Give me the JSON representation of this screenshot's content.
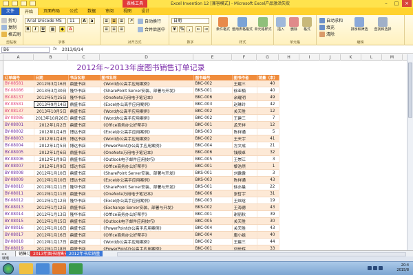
{
  "window": {
    "context_tab": "表格工具",
    "title": "Excel Invention 12 [兼容模式] - Microsoft Excel产品激活失败"
  },
  "ribbon_tabs": [
    "文件",
    "开始",
    "页面布局",
    "公式",
    "数据",
    "审阅",
    "视图",
    "设计"
  ],
  "ribbon": {
    "clipboard": {
      "cut": "剪切",
      "copy": "复制",
      "format_painter": "格式刷",
      "paste": "粘贴",
      "group": "剪贴板"
    },
    "font": {
      "name": "Arial Unicode MS",
      "size": "11",
      "group": "字体"
    },
    "alignment": {
      "wrap": "自动换行",
      "merge": "合并后居中",
      "group": "对齐方式"
    },
    "number": {
      "format": "日期",
      "group": "数字"
    },
    "styles": {
      "conditional": "条件格式",
      "table": "套用表格格式",
      "cell": "单元格样式",
      "group": "样式"
    },
    "cells": {
      "insert": "插入",
      "delete": "删除",
      "format": "格式",
      "group": "单元格"
    },
    "editing": {
      "autosum": "自动求和",
      "fill": "填充",
      "clear": "清除",
      "sort": "排序和筛选",
      "find": "查找和选择",
      "group": "编辑"
    }
  },
  "formula_bar": {
    "name_box": "B6",
    "fx": "fx",
    "value": "2013/9/14"
  },
  "columns": [
    "A",
    "B",
    "C",
    "D",
    "E",
    "F",
    "G",
    "H",
    "I",
    "J",
    "K",
    "L",
    "M",
    "N"
  ],
  "sheet": {
    "title": "2012年~2013年度图书销售订单记录",
    "headers": [
      "订单编号",
      "日期",
      "书店名称",
      "图书名称",
      "图书编号",
      "图书作者",
      "销量（本）"
    ],
    "rows": [
      {
        "num": "BY-08581",
        "date": "2012年3月16日",
        "store": "鼎盛书店",
        "book": "《Word办公高手应用案例》",
        "code": "BKC-002",
        "author": "王建三",
        "qty": "40"
      },
      {
        "num": "BY-08086",
        "date": "2013年3月30日",
        "store": "隆华书店",
        "book": "《SharePoint Server安装、部署与开发》",
        "code": "BKS-001",
        "author": "徐亚楠",
        "qty": "40"
      },
      {
        "num": "BY-08137",
        "date": "2012年5月25日",
        "store": "隆华书店",
        "book": "《OneNote万用电子笔记本》",
        "code": "BKC-006",
        "author": "余耀明",
        "qty": "49"
      },
      {
        "num": "BY-08581",
        "date": "2013年9月14日",
        "store": "鼎盛书店",
        "book": "《Excel办公高手应用案例》",
        "code": "BKC-003",
        "author": "赵琳玲",
        "qty": "42"
      },
      {
        "num": "BY-08137",
        "date": "2013年10月5日",
        "store": "鼎盛书店",
        "book": "《Word办公高手应用案例》",
        "code": "BKC-002",
        "author": "关天胜",
        "qty": "12"
      },
      {
        "num": "BY-08086",
        "date": "2013年10月26日",
        "store": "鼎盛书店",
        "book": "《Word办公高手应用案例》",
        "code": "BKC-002",
        "author": "王建三",
        "qty": "7"
      },
      {
        "num": "BY-08001",
        "date": "2012年1月2日",
        "store": "鼎盛书店",
        "book": "《Office商务办公好帮手》",
        "code": "BKC-001",
        "author": "孟天祥",
        "qty": "12"
      },
      {
        "num": "BY-08002",
        "date": "2012年1月4日",
        "store": "博达书店",
        "book": "《Excel办公高手应用案例》",
        "code": "BKS-003",
        "author": "陈祥通",
        "qty": "5"
      },
      {
        "num": "BY-08003",
        "date": "2012年1月4日",
        "store": "博达书店",
        "book": "《Word办公高手应用案例》",
        "code": "BKC-002",
        "author": "王天宇",
        "qty": "41"
      },
      {
        "num": "BY-08004",
        "date": "2012年1月5日",
        "store": "博达书店",
        "book": "《PowerPoint办公高手应用案例》",
        "code": "BKC-004",
        "author": "方文成",
        "qty": "21"
      },
      {
        "num": "BY-08005",
        "date": "2012年1月6日",
        "store": "鼎盛书店",
        "book": "《OneNote万用电子笔记本》",
        "code": "BKC-006",
        "author": "钱顺卓",
        "qty": "32"
      },
      {
        "num": "BY-08006",
        "date": "2012年1月9日",
        "store": "鼎盛书店",
        "book": "《Outlook电子邮件应用技巧》",
        "code": "BKC-005",
        "author": "王崇江",
        "qty": "3"
      },
      {
        "num": "BY-08007",
        "date": "2012年1月9日",
        "store": "博达书店",
        "book": "《Office商务办公好帮手》",
        "code": "BKC-001",
        "author": "黎浩然",
        "qty": "1"
      },
      {
        "num": "BY-08008",
        "date": "2012年1月10日",
        "store": "鼎盛书店",
        "book": "《SharePoint Server安装、部署与开发》",
        "code": "BKS-001",
        "author": "刘露露",
        "qty": "3"
      },
      {
        "num": "BY-08009",
        "date": "2012年1月10日",
        "store": "博达书店",
        "book": "《Excel办公高手应用案例》",
        "code": "BKS-003",
        "author": "陈祥通",
        "qty": "43"
      },
      {
        "num": "BY-08010",
        "date": "2012年1月11日",
        "store": "隆华书店",
        "book": "《SharePoint Server安装、部署与开发》",
        "code": "BKS-001",
        "author": "徐亦晨",
        "qty": "22"
      },
      {
        "num": "BY-08011",
        "date": "2012年1月11日",
        "store": "鼎盛书店",
        "book": "《OneNote万用电子笔记本》",
        "code": "BKC-006",
        "author": "张哲宇",
        "qty": "31"
      },
      {
        "num": "BY-08012",
        "date": "2012年1月12日",
        "store": "隆华书店",
        "book": "《Excel办公高手应用案例》",
        "code": "BKC-003",
        "author": "王炫晗",
        "qty": "19"
      },
      {
        "num": "BY-08013",
        "date": "2012年1月12日",
        "store": "鼎盛书店",
        "book": "《Exchange Server安装、部署与开发》",
        "code": "BKS-002",
        "author": "王海德",
        "qty": "43"
      },
      {
        "num": "BY-08014",
        "date": "2012年1月13日",
        "store": "隆华书店",
        "book": "《Office商务办公好帮手》",
        "code": "BKC-001",
        "author": "谢丽秋",
        "qty": "39"
      },
      {
        "num": "BY-08015",
        "date": "2012年1月15日",
        "store": "鼎盛书店",
        "book": "《Outlook电子邮件应用技巧》",
        "code": "BKC-005",
        "author": "关天胜",
        "qty": "30"
      },
      {
        "num": "BY-08016",
        "date": "2012年1月16日",
        "store": "鼎盛书店",
        "book": "《PowerPoint办公高手应用案例》",
        "code": "BKC-004",
        "author": "关天胜",
        "qty": "43"
      },
      {
        "num": "BY-08017",
        "date": "2012年1月16日",
        "store": "鼎盛书店",
        "book": "《Office商务办公好帮手》",
        "code": "BKC-004",
        "author": "唐小姐",
        "qty": "40"
      },
      {
        "num": "BY-08018",
        "date": "2012年1月17日",
        "store": "鼎盛书店",
        "book": "《Word办公高手应用案例》",
        "code": "BKC-002",
        "author": "王建三",
        "qty": "44"
      },
      {
        "num": "BY-08019",
        "date": "2012年1月18日",
        "store": "鼎盛书店",
        "book": "《PowerPoint办公高手应用案例》",
        "code": "BKC-001",
        "author": "刘长辉",
        "qty": "33"
      }
    ]
  },
  "sheet_tabs": [
    "销售订单",
    "2013年图书销售分析",
    "2012年书店销量"
  ],
  "status": "就绪",
  "clock": {
    "time": "20:4",
    "date": "2015/8"
  },
  "colors": {
    "header_orange": "#f08c3c",
    "band": "#fde9d6",
    "title_purple": "#7a2aa8",
    "ribbon_yellow": "#ffd22e"
  }
}
